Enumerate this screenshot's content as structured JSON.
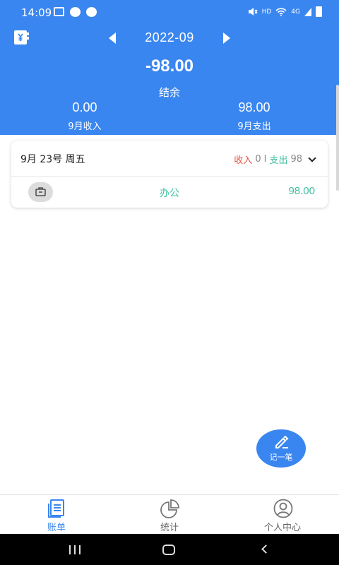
{
  "status_bar": {
    "time": "14:09",
    "hd_label": "HD",
    "network_label": "4G"
  },
  "header": {
    "month": "2022-09",
    "balance": "-98.00",
    "balance_label": "结余",
    "income_value": "0.00",
    "income_label": "9月收入",
    "expense_value": "98.00",
    "expense_label": "9月支出"
  },
  "day_card": {
    "date": "9月 23号 周五",
    "income_label": "收入",
    "income_value": "0",
    "separator": "I",
    "expense_label": "支出",
    "expense_value": "98",
    "entries": [
      {
        "category": "办公",
        "amount": "98.00",
        "icon": "briefcase-icon"
      }
    ]
  },
  "fab": {
    "label": "记一笔",
    "icon": "pencil-icon"
  },
  "bottom_nav": {
    "items": [
      {
        "label": "账单",
        "icon": "bill-icon",
        "active": true
      },
      {
        "label": "统计",
        "icon": "pie-chart-icon",
        "active": false
      },
      {
        "label": "个人中心",
        "icon": "user-icon",
        "active": false
      }
    ]
  },
  "colors": {
    "primary": "#3a86f0",
    "income": "#e5533d",
    "expense": "#3fbf9f"
  }
}
